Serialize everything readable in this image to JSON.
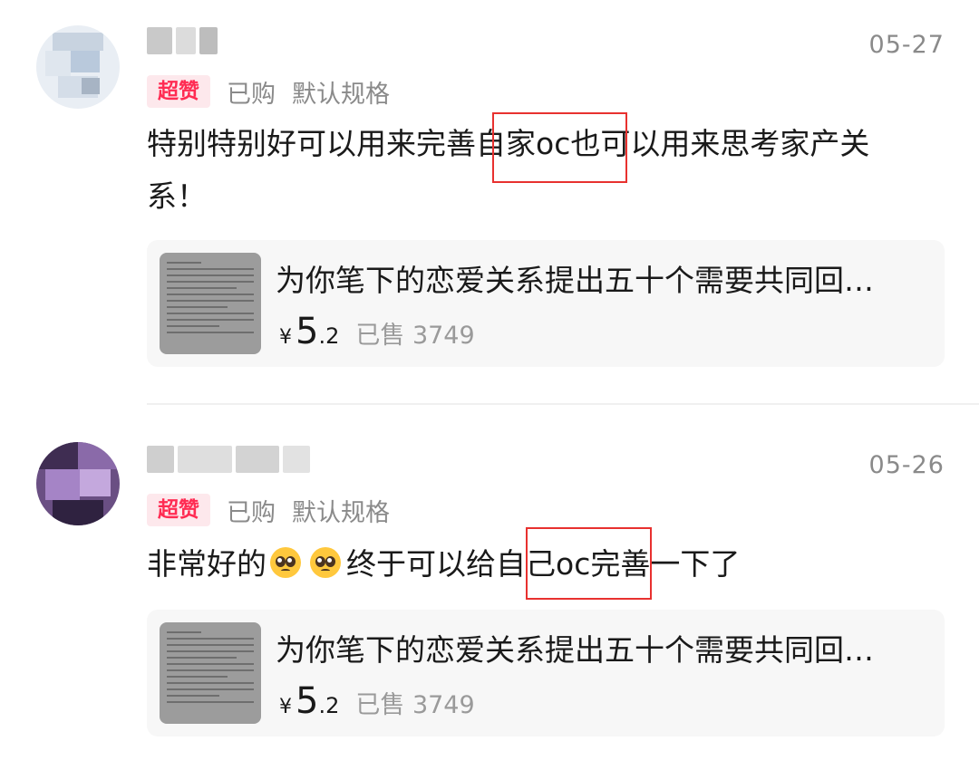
{
  "reviews": [
    {
      "date": "05-27",
      "badge": "超赞",
      "purchased": "已购",
      "spec": "默认规格",
      "content_line1": "特别特别好可以用来完善自家oc也可以用来思考家产关",
      "content_line2": "系！",
      "product": {
        "title": "为你笔下的恋爱关系提出五十个需要共同回…",
        "currency": "¥",
        "price_int": "5",
        "price_dec": ".2",
        "sold": "已售 3749"
      }
    },
    {
      "date": "05-26",
      "badge": "超赞",
      "purchased": "已购",
      "spec": "默认规格",
      "content_before": "非常好的",
      "emoji": "pleading-face-icon",
      "content_after": "终于可以给自己oc完善一下了",
      "product": {
        "title": "为你笔下的恋爱关系提出五十个需要共同回…",
        "currency": "¥",
        "price_int": "5",
        "price_dec": ".2",
        "sold": "已售 3749"
      }
    }
  ],
  "colors": {
    "badge_text": "#ff2b52",
    "badge_bg": "#fde8ec",
    "highlight_border": "#e8312f",
    "muted_text": "#8a8a8a"
  }
}
